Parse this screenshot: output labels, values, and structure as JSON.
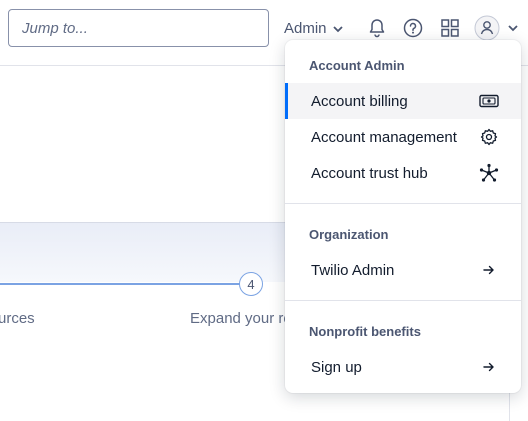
{
  "topbar": {
    "jump_placeholder": "Jump to...",
    "account_menu_label": "Admin"
  },
  "icons": {
    "notifications": "bell-icon",
    "help": "help-circle-icon",
    "apps": "grid-icon",
    "user": "user-avatar-icon"
  },
  "progress": {
    "step_number": "4",
    "prev_label_partial": "urces",
    "next_label_partial": "Expand your re"
  },
  "menu": {
    "section_account_admin": "Account Admin",
    "account_billing": "Account billing",
    "account_management": "Account management",
    "account_trust_hub": "Account trust hub",
    "section_organization": "Organization",
    "twilio_admin": "Twilio Admin",
    "section_nonprofit": "Nonprofit benefits",
    "sign_up": "Sign up"
  },
  "colors": {
    "active_indicator": "#006dfa",
    "progress_line": "#7ba3e3",
    "text_primary": "#121c2d",
    "text_secondary": "#4b5671"
  }
}
